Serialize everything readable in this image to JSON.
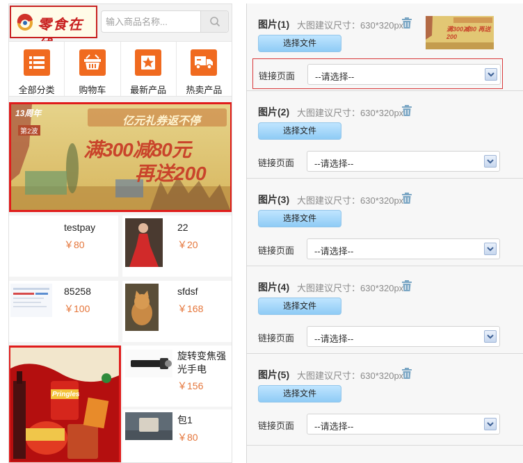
{
  "header": {
    "logo_text": "零食在线",
    "search_placeholder": "输入商品名称..."
  },
  "nav": [
    {
      "label": "全部分类",
      "icon": "list-icon"
    },
    {
      "label": "购物车",
      "icon": "basket-icon"
    },
    {
      "label": "最新产品",
      "icon": "star-icon"
    },
    {
      "label": "热卖产品",
      "icon": "truck-icon"
    }
  ],
  "banner": {
    "line1": "13周年",
    "line2": "第2波",
    "line3": "亿元礼券返不停",
    "line4": "满300减80元",
    "line5": "再送200"
  },
  "products": [
    {
      "name": "testpay",
      "price": "￥80"
    },
    {
      "name": "22",
      "price": "￥20"
    },
    {
      "name": "85258",
      "price": "￥100"
    },
    {
      "name": "sfdsf",
      "price": "￥168"
    },
    {
      "name": "旋转变焦强光手电",
      "price": "￥156"
    },
    {
      "name": "包1",
      "price": "￥80"
    }
  ],
  "promo": {
    "text": "Pringles"
  },
  "slots": [
    {
      "title": "图片(1)",
      "hint": "大图建议尺寸：630*320px",
      "button": "选择文件",
      "link_label": "链接页面",
      "select_value": "--请选择--",
      "thumb_text": "满300减80 再送200"
    },
    {
      "title": "图片(2)",
      "hint": "大图建议尺寸：630*320px",
      "button": "选择文件",
      "link_label": "链接页面",
      "select_value": "--请选择--"
    },
    {
      "title": "图片(3)",
      "hint": "大图建议尺寸：630*320px",
      "button": "选择文件",
      "link_label": "链接页面",
      "select_value": "--请选择--"
    },
    {
      "title": "图片(4)",
      "hint": "大图建议尺寸：630*320px",
      "button": "选择文件",
      "link_label": "链接页面",
      "select_value": "--请选择--"
    },
    {
      "title": "图片(5)",
      "hint": "大图建议尺寸：630*320px",
      "button": "选择文件",
      "link_label": "链接页面",
      "select_value": "--请选择--"
    }
  ],
  "colors": {
    "accent_orange": "#f06a1f",
    "price_orange": "#e5763b",
    "highlight_red": "#e01b1b",
    "button_blue": "#8fcbf5"
  }
}
